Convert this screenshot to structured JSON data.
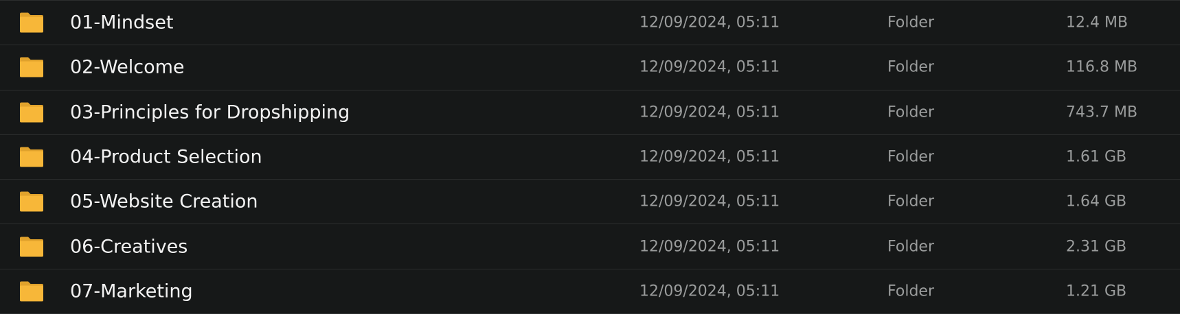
{
  "colors": {
    "background": "#161818",
    "divider": "#2c2e2e",
    "folder_icon": "#f7b739",
    "name_text": "#f2f2f2",
    "meta_text": "#9a9c9c"
  },
  "rows": [
    {
      "icon": "folder-icon",
      "name": "01-Mindset",
      "date": "12/09/2024, 05:11",
      "type": "Folder",
      "size": "12.4 MB"
    },
    {
      "icon": "folder-icon",
      "name": "02-Welcome",
      "date": "12/09/2024, 05:11",
      "type": "Folder",
      "size": "116.8 MB"
    },
    {
      "icon": "folder-icon",
      "name": "03-Principles for Dropshipping",
      "date": "12/09/2024, 05:11",
      "type": "Folder",
      "size": "743.7 MB"
    },
    {
      "icon": "folder-icon",
      "name": "04-Product Selection",
      "date": "12/09/2024, 05:11",
      "type": "Folder",
      "size": "1.61 GB"
    },
    {
      "icon": "folder-icon",
      "name": "05-Website Creation",
      "date": "12/09/2024, 05:11",
      "type": "Folder",
      "size": "1.64 GB"
    },
    {
      "icon": "folder-icon",
      "name": "06-Creatives",
      "date": "12/09/2024, 05:11",
      "type": "Folder",
      "size": "2.31 GB"
    },
    {
      "icon": "folder-icon",
      "name": "07-Marketing",
      "date": "12/09/2024, 05:11",
      "type": "Folder",
      "size": "1.21 GB"
    }
  ]
}
